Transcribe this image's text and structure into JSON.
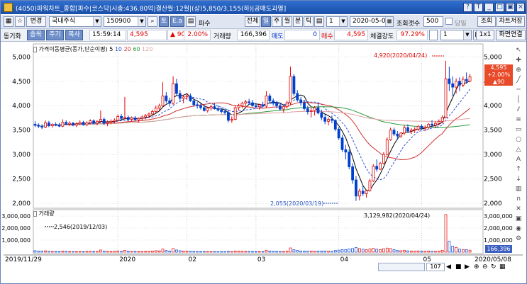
{
  "window": {
    "title": "(4050)파워차트_종합[파수|코스닥|시총:436.80억|결산월:12월|(상)5,850/3,155(하)|공매도과열]"
  },
  "toolbar": {
    "change_label": "변경",
    "market": "국내주식",
    "code": "150900",
    "name": "파수",
    "btn_toh": "토",
    "btn_ea": "E.a",
    "period_buttons": [
      "전체",
      "일",
      "주",
      "월",
      "분",
      "틱"
    ],
    "period_value": "1",
    "date": "2020-05-08",
    "count_label": "조회갯수",
    "count_value": "500",
    "append_label": "당일"
  },
  "infobar": {
    "sync_label": "동기화",
    "tabs": [
      "종목",
      "주기",
      "복사"
    ],
    "time": "15:59:14",
    "price": "4,595",
    "change_arrow": "▲",
    "change": "90",
    "rate": "2.00%",
    "volume_label": "거래량",
    "volume": "166,396",
    "sell_label": "매도",
    "sell_value": "0",
    "buy_label": "매수",
    "buy_value": "4,595",
    "strength_label": "체결강도",
    "strength_value": "97.29%",
    "page_value": "1",
    "zoom": "1x1",
    "screen_label": "화면연결"
  },
  "side": {
    "lookup": "조회",
    "save": "차트저장"
  },
  "price_panel": {
    "title": "가격이동평균(종가,단순이평)",
    "ma_periods": [
      "5",
      "10",
      "20",
      "60",
      "120"
    ],
    "ma_colors": [
      "#000000",
      "#3050d0",
      "#d03030",
      "#2a9a3a",
      "#e0a0a0"
    ],
    "y_ticks": [
      "5,000",
      "4,500",
      "4,000",
      "3,500",
      "3,000",
      "2,500",
      "2,000"
    ],
    "high_annotation": "4,920(2020/04/24)",
    "low_annotation": "2,055(2020/03/19)",
    "current_price": "4,595",
    "current_rate": "+2.00%",
    "current_change": "▲90"
  },
  "volume_panel": {
    "title": "거래량",
    "y_ticks": [
      "3,000,000",
      "2,000,000",
      "1,000,000"
    ],
    "high_annotation": "3,129,982(2020/04/24)",
    "low_annotation": "2,546(2019/12/03)",
    "current_volume": "166,396"
  },
  "x_axis": {
    "labels": [
      "2019/11/29",
      "2020",
      "02",
      "03",
      "04",
      "05",
      "2020/05/08"
    ]
  },
  "scroll": {
    "value": "107"
  },
  "chart_data": {
    "type": "candlestick",
    "title": "",
    "price_range": [
      1930,
      5120
    ],
    "volume_max": 3300000,
    "candles": [
      [
        3620,
        3680,
        3560,
        3600,
        120000
      ],
      [
        3600,
        3640,
        3540,
        3580,
        90000
      ],
      [
        3580,
        3620,
        3520,
        3560,
        80000
      ],
      [
        3560,
        3700,
        3540,
        3650,
        110000
      ],
      [
        3650,
        3690,
        3560,
        3590,
        70000
      ],
      [
        3590,
        3640,
        3550,
        3620,
        60000
      ],
      [
        3620,
        3660,
        3580,
        3600,
        50000
      ],
      [
        3600,
        3650,
        3560,
        3580,
        40000
      ],
      [
        3580,
        3720,
        3560,
        3660,
        90000
      ],
      [
        3660,
        3700,
        3600,
        3620,
        60000
      ],
      [
        3620,
        3680,
        3580,
        3640,
        50000
      ],
      [
        3640,
        3670,
        3580,
        3600,
        40000
      ],
      [
        3600,
        3660,
        3560,
        3630,
        45000
      ],
      [
        3630,
        3700,
        3600,
        3660,
        50000
      ],
      [
        3660,
        3690,
        3590,
        3610,
        40000
      ],
      [
        3610,
        3680,
        3580,
        3650,
        60000
      ],
      [
        3650,
        3720,
        3620,
        3690,
        70000
      ],
      [
        3690,
        3720,
        3620,
        3640,
        50000
      ],
      [
        3640,
        3700,
        3600,
        3680,
        60000
      ],
      [
        3680,
        3900,
        3660,
        3720,
        180000
      ],
      [
        3720,
        3760,
        3600,
        3640,
        80000
      ],
      [
        3640,
        3700,
        3580,
        3660,
        60000
      ],
      [
        3660,
        3720,
        3620,
        3680,
        50000
      ],
      [
        3680,
        3740,
        3640,
        3700,
        60000
      ],
      [
        3700,
        3820,
        3680,
        3780,
        90000
      ],
      [
        3780,
        3830,
        3700,
        3740,
        60000
      ],
      [
        3740,
        4180,
        3720,
        3760,
        150000
      ],
      [
        3760,
        3800,
        3680,
        3720,
        70000
      ],
      [
        3720,
        3780,
        3680,
        3750,
        60000
      ],
      [
        3750,
        3790,
        3690,
        3710,
        50000
      ],
      [
        3710,
        3760,
        3660,
        3740,
        45000
      ],
      [
        3740,
        3800,
        3700,
        3770,
        50000
      ],
      [
        3770,
        3830,
        3720,
        3800,
        60000
      ],
      [
        3800,
        3860,
        3750,
        3830,
        70000
      ],
      [
        3830,
        3920,
        3800,
        3880,
        90000
      ],
      [
        3880,
        4000,
        3850,
        3950,
        120000
      ],
      [
        3950,
        4040,
        3900,
        4000,
        110000
      ],
      [
        4000,
        4480,
        3980,
        4200,
        260000
      ],
      [
        4200,
        4280,
        4050,
        4100,
        140000
      ],
      [
        4100,
        4160,
        3980,
        4050,
        90000
      ],
      [
        4050,
        4600,
        4020,
        4450,
        300000
      ],
      [
        4450,
        4550,
        4200,
        4250,
        180000
      ],
      [
        4250,
        4320,
        4100,
        4150,
        120000
      ],
      [
        4150,
        4220,
        4050,
        4180,
        90000
      ],
      [
        4180,
        4260,
        4120,
        4200,
        80000
      ],
      [
        4200,
        4250,
        4080,
        4100,
        70000
      ],
      [
        4100,
        4150,
        3980,
        4020,
        60000
      ],
      [
        4020,
        4080,
        3940,
        4000,
        50000
      ],
      [
        4000,
        4060,
        3920,
        3960,
        45000
      ],
      [
        3960,
        4020,
        3880,
        3900,
        50000
      ],
      [
        3900,
        3980,
        3860,
        3950,
        45000
      ],
      [
        3950,
        4020,
        3900,
        3980,
        50000
      ],
      [
        3980,
        4050,
        3920,
        3940,
        40000
      ],
      [
        3940,
        4000,
        3880,
        3910,
        35000
      ],
      [
        3910,
        3960,
        3840,
        3880,
        40000
      ],
      [
        3880,
        3940,
        3820,
        3860,
        35000
      ],
      [
        3860,
        3920,
        3660,
        3700,
        60000
      ],
      [
        3700,
        3780,
        3650,
        3720,
        40000
      ],
      [
        3720,
        4000,
        3700,
        3960,
        90000
      ],
      [
        3960,
        4040,
        3900,
        4000,
        80000
      ],
      [
        4000,
        4080,
        3950,
        4050,
        70000
      ],
      [
        4050,
        4120,
        3990,
        4080,
        60000
      ],
      [
        4080,
        4140,
        4020,
        4060,
        55000
      ],
      [
        4060,
        4120,
        3980,
        4000,
        50000
      ],
      [
        4000,
        4060,
        3940,
        3980,
        45000
      ],
      [
        3980,
        4040,
        3920,
        4020,
        50000
      ],
      [
        4020,
        4080,
        3960,
        3990,
        40000
      ],
      [
        3990,
        4300,
        3960,
        4200,
        160000
      ],
      [
        4200,
        4250,
        4060,
        4100,
        90000
      ],
      [
        4100,
        4150,
        4000,
        4050,
        70000
      ],
      [
        4050,
        4100,
        3950,
        4000,
        60000
      ],
      [
        4000,
        4060,
        3900,
        3930,
        50000
      ],
      [
        3930,
        4000,
        3860,
        3980,
        55000
      ],
      [
        3980,
        4100,
        3940,
        4060,
        80000
      ],
      [
        4060,
        4800,
        4020,
        4600,
        350000
      ],
      [
        4600,
        4650,
        4200,
        4250,
        200000
      ],
      [
        4250,
        4320,
        4080,
        4120,
        140000
      ],
      [
        4120,
        4180,
        4000,
        4060,
        100000
      ],
      [
        4060,
        4120,
        3900,
        3940,
        90000
      ],
      [
        3940,
        4000,
        3820,
        3880,
        80000
      ],
      [
        3880,
        3960,
        3760,
        3900,
        90000
      ],
      [
        3900,
        3990,
        3800,
        3960,
        70000
      ],
      [
        3960,
        4050,
        3820,
        3850,
        80000
      ],
      [
        3850,
        3920,
        3700,
        3760,
        90000
      ],
      [
        3760,
        3820,
        3620,
        3680,
        100000
      ],
      [
        3680,
        3760,
        3600,
        3720,
        80000
      ],
      [
        3720,
        3800,
        3640,
        3700,
        70000
      ],
      [
        3700,
        3720,
        3480,
        3520,
        140000
      ],
      [
        3520,
        3560,
        3300,
        3340,
        170000
      ],
      [
        3340,
        3400,
        3050,
        3100,
        200000
      ],
      [
        3100,
        3200,
        2900,
        3050,
        220000
      ],
      [
        3050,
        3100,
        2700,
        2750,
        260000
      ],
      [
        2750,
        2820,
        2400,
        2480,
        300000
      ],
      [
        2480,
        2560,
        2050,
        2150,
        380000
      ],
      [
        2150,
        2300,
        2060,
        2250,
        300000
      ],
      [
        2250,
        2350,
        2150,
        2200,
        240000
      ],
      [
        2200,
        2280,
        2120,
        2260,
        200000
      ],
      [
        2260,
        2500,
        2240,
        2460,
        260000
      ],
      [
        2460,
        2800,
        2440,
        2760,
        320000
      ],
      [
        2760,
        2900,
        2650,
        2700,
        240000
      ],
      [
        2700,
        2850,
        2680,
        2820,
        220000
      ],
      [
        2820,
        3050,
        2800,
        3000,
        280000
      ],
      [
        3000,
        3350,
        2980,
        3300,
        340000
      ],
      [
        3300,
        3550,
        3280,
        3500,
        300000
      ],
      [
        3500,
        3550,
        3380,
        3420,
        200000
      ],
      [
        3420,
        3480,
        3300,
        3380,
        150000
      ],
      [
        3380,
        3460,
        3340,
        3440,
        120000
      ],
      [
        3440,
        3600,
        3400,
        3550,
        160000
      ],
      [
        3550,
        3620,
        3450,
        3480,
        110000
      ],
      [
        3480,
        3540,
        3420,
        3500,
        90000
      ],
      [
        3500,
        3560,
        3440,
        3520,
        80000
      ],
      [
        3520,
        3600,
        3480,
        3580,
        100000
      ],
      [
        3580,
        3620,
        3500,
        3540,
        80000
      ],
      [
        3540,
        3600,
        3480,
        3560,
        70000
      ],
      [
        3560,
        3650,
        3520,
        3620,
        90000
      ],
      [
        3620,
        3700,
        3560,
        3600,
        80000
      ],
      [
        3600,
        3680,
        3540,
        3640,
        70000
      ],
      [
        3640,
        3720,
        3600,
        3680,
        90000
      ],
      [
        3680,
        3800,
        3640,
        3760,
        160000
      ],
      [
        3760,
        4920,
        3740,
        4550,
        3129982
      ],
      [
        4550,
        4800,
        4300,
        4450,
        900000
      ],
      [
        4450,
        4600,
        4200,
        4380,
        500000
      ],
      [
        4380,
        4560,
        4250,
        4500,
        400000
      ],
      [
        4500,
        4580,
        4300,
        4420,
        250000
      ],
      [
        4420,
        4600,
        4380,
        4540,
        220000
      ],
      [
        4540,
        4680,
        4450,
        4505,
        200000
      ],
      [
        4505,
        4650,
        4480,
        4595,
        166396
      ]
    ]
  }
}
